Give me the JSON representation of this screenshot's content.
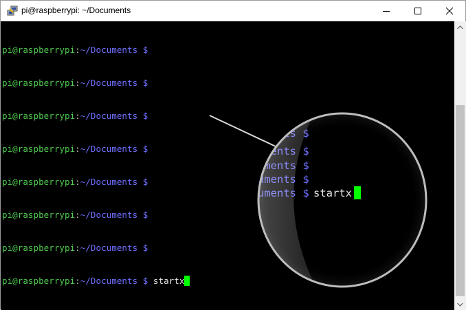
{
  "window": {
    "title": "pi@raspberrypi: ~/Documents"
  },
  "terminal": {
    "prompt_user": "pi@raspberrypi",
    "prompt_sep": ":",
    "prompt_path": "~/Documents $",
    "command": "startx",
    "history_lines": 7
  },
  "magnifier": {
    "lines": [
      "uments $",
      "uments $",
      "uments $",
      "uments $",
      "uments $"
    ],
    "last_line_prefix": "uments $",
    "last_line_cmd": "startx"
  },
  "colors": {
    "prompt_user": "#4ec94e",
    "prompt_path": "#6f6fff",
    "command": "#e8e8e8",
    "cursor": "#00ff00",
    "background": "#000000"
  }
}
